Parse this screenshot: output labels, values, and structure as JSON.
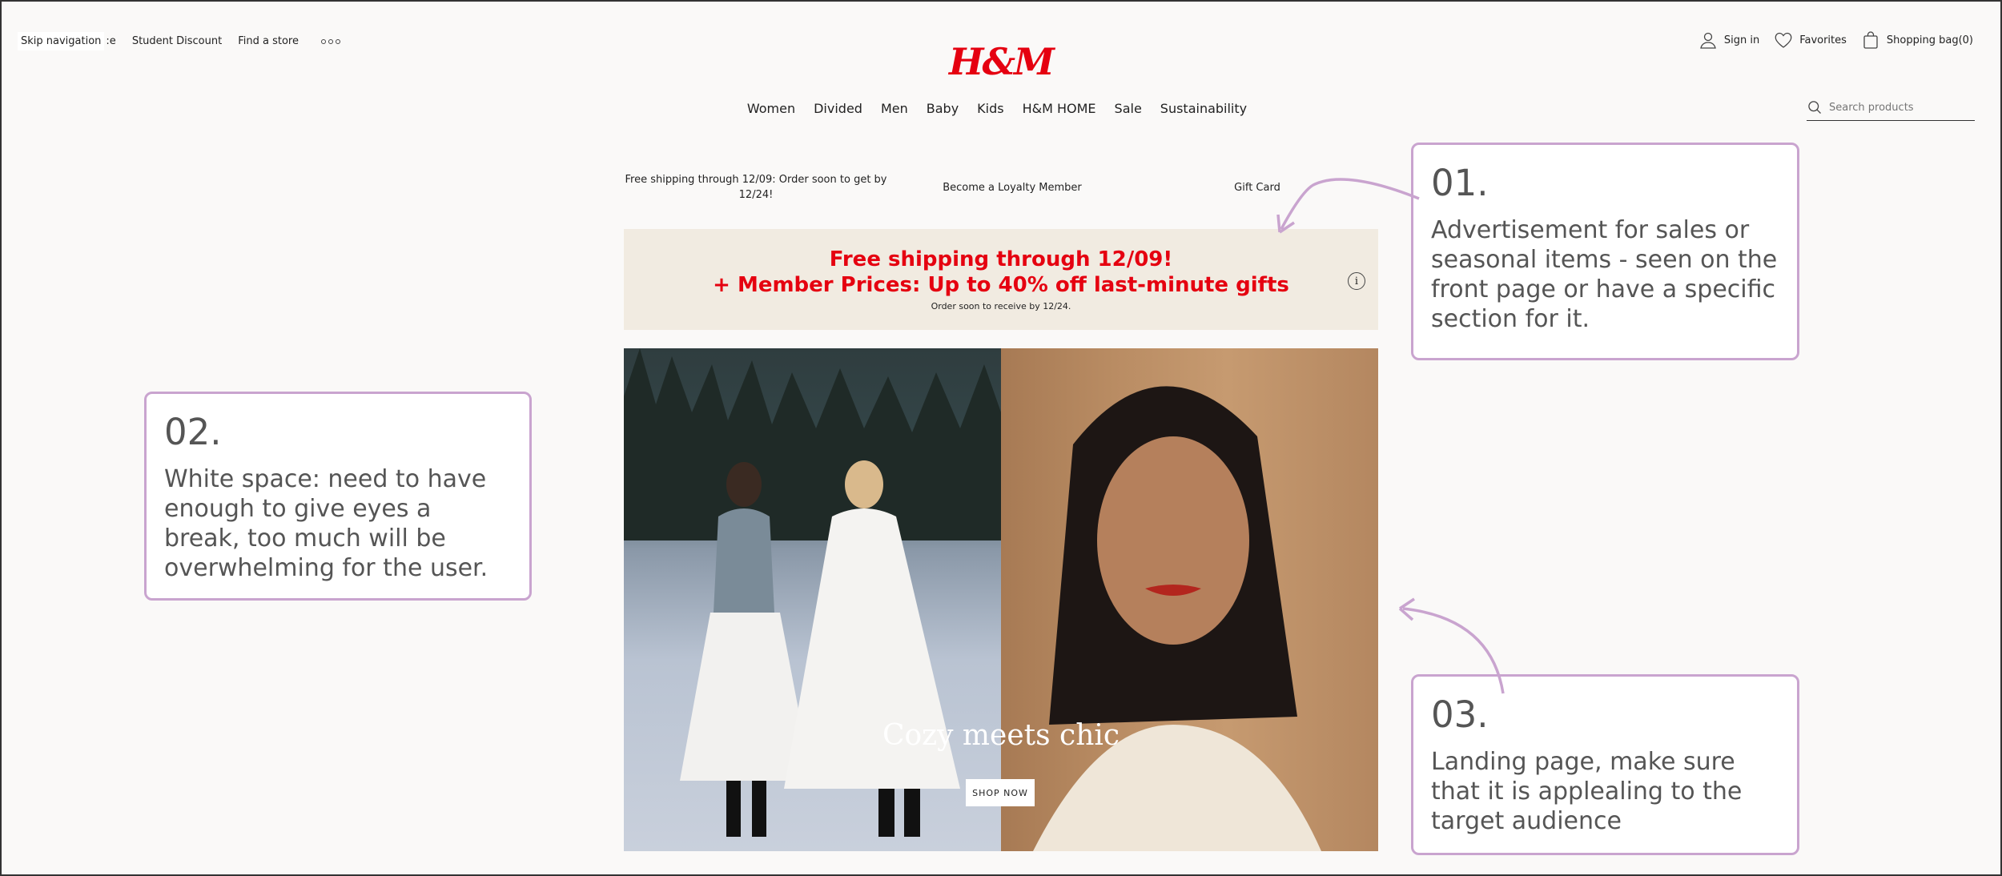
{
  "utility": {
    "skip_nav": "Skip navigation",
    "skip_tail": ":e",
    "student_discount": "Student Discount",
    "find_store": "Find a store",
    "sign_in": "Sign in",
    "favorites": "Favorites",
    "shopping_bag": "Shopping bag(0)"
  },
  "logo": "H&M",
  "nav": [
    "Women",
    "Divided",
    "Men",
    "Baby",
    "Kids",
    "H&M HOME",
    "Sale",
    "Sustainability"
  ],
  "search": {
    "placeholder": "Search products"
  },
  "promo_strip": {
    "shipping": "Free shipping through 12/09: Order soon to get by 12/24!",
    "loyalty": "Become a Loyalty Member",
    "gift_card": "Gift Card"
  },
  "banner": {
    "line1": "Free shipping through 12/09!",
    "line2": "+ Member Prices: Up to 40% off last-minute gifts",
    "small": "Order soon to receive by 12/24."
  },
  "hero": {
    "title": "Cozy meets chic",
    "cta": "SHOP NOW"
  },
  "annotations": [
    {
      "num": "01.",
      "text": "Advertisement for sales or seasonal items - seen on the front page or have a specific section for it."
    },
    {
      "num": "02.",
      "text": "White space: need to have enough to give eyes a break, too much will be overwhelming for the user."
    },
    {
      "num": "03.",
      "text": "Landing page, make sure that it is applealing to the target audience"
    }
  ],
  "colors": {
    "brand_red": "#e50010",
    "annotation_border": "#c9a4cf",
    "banner_bg": "#f1ebe1",
    "page_bg": "#faf9f8"
  }
}
